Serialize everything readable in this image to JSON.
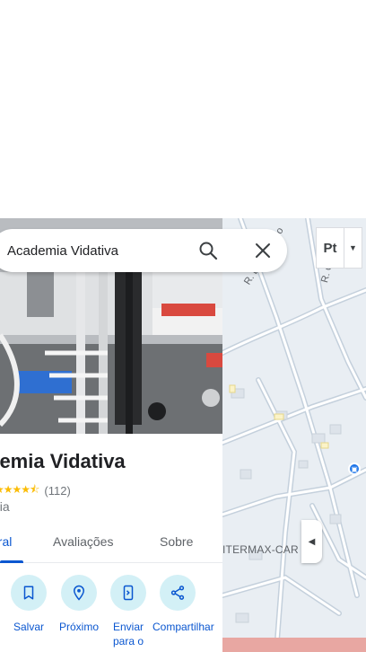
{
  "search": {
    "value": "Academia Vidativa",
    "icon": "search-icon",
    "clear_icon": "close-icon"
  },
  "place": {
    "title": "demia Vidativa",
    "rating_count": "(112)",
    "rating": 4.5,
    "category": "nia"
  },
  "tabs": [
    {
      "label": "eral",
      "active": true
    },
    {
      "label": "Avaliações",
      "active": false
    },
    {
      "label": "Sobre",
      "active": false
    }
  ],
  "actions": [
    {
      "label": "Salvar",
      "icon": "bookmark-icon"
    },
    {
      "label": "Próximo",
      "icon": "nearby-icon"
    },
    {
      "label": "Enviar para o",
      "icon": "send-to-phone-icon"
    },
    {
      "label": "Compartilhar",
      "icon": "share-icon"
    }
  ],
  "map": {
    "streets": [
      "R. Dom Basilio",
      "R. C"
    ],
    "label": "ITERMAX-CAR",
    "layer_label": "Pt"
  },
  "colors": {
    "accent": "#0b57d0",
    "action_bg": "#d3f0f6",
    "star": "#fbbc04",
    "map_bg": "#e9eef3"
  }
}
